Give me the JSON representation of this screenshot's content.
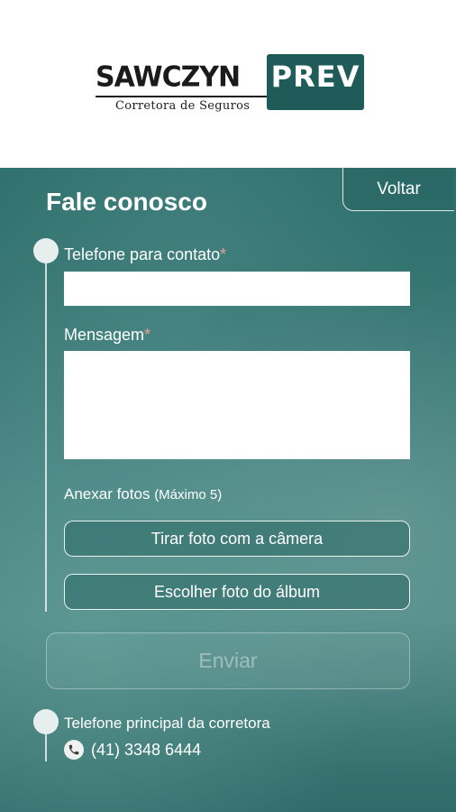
{
  "logo": {
    "main": "SAWCZYN",
    "accent": "PREV",
    "subtitle": "Corretora de Seguros"
  },
  "header": {
    "title": "Fale conosco",
    "back_label": "Voltar"
  },
  "form": {
    "phone_label": "Telefone para contato",
    "message_label": "Mensagem",
    "required_mark": "*",
    "phone_value": "",
    "message_value": "",
    "attach_label": "Anexar fotos",
    "attach_hint": "(Máximo 5)",
    "camera_button": "Tirar foto com a câmera",
    "album_button": "Escolher foto do álbum",
    "send_button": "Enviar"
  },
  "contact": {
    "label": "Telefone principal da corretora",
    "phone": "(41) 3348 6444"
  },
  "colors": {
    "brand": "#1f5b59",
    "panel": "#3e7b78",
    "required": "#e8a0a0"
  },
  "icons": {
    "phone": "phone-icon"
  }
}
